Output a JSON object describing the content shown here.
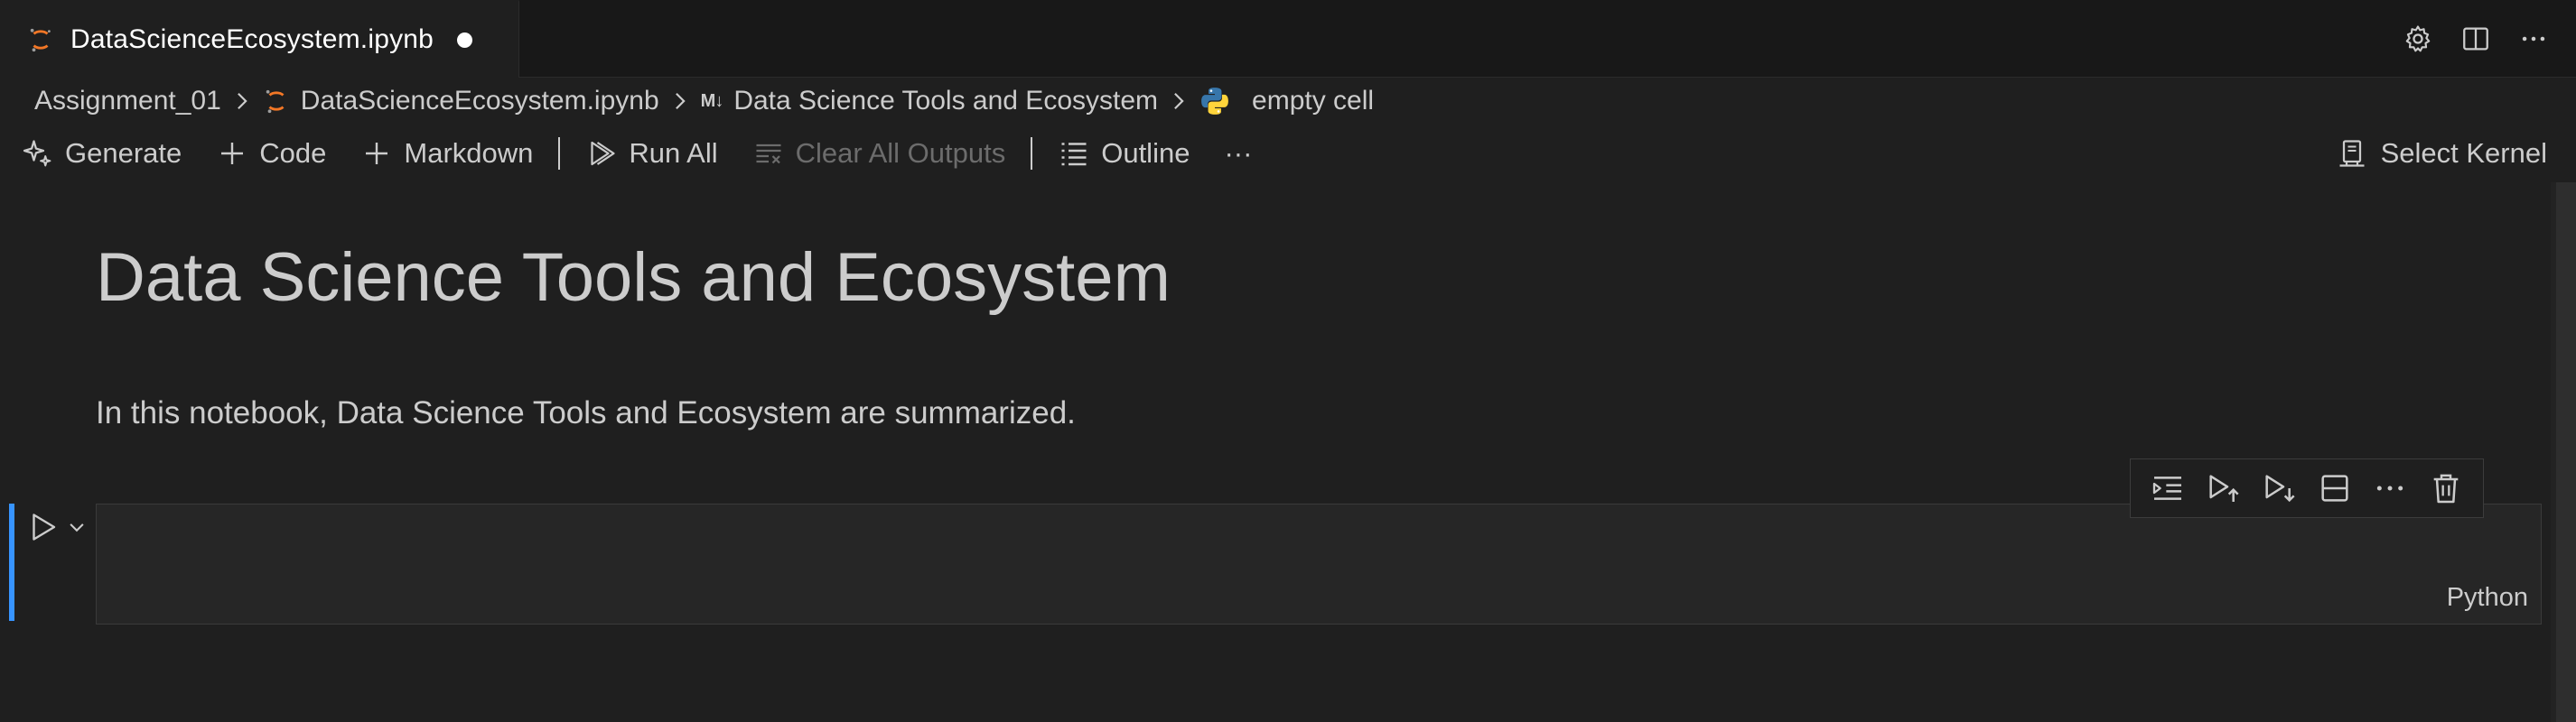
{
  "tab": {
    "title": "DataScienceEcosystem.ipynb",
    "icons": {
      "file": "jupyter-icon",
      "actions": [
        "gear-icon",
        "split-editor-icon",
        "more-icon"
      ]
    }
  },
  "breadcrumb": {
    "items": [
      "Assignment_01",
      "DataScienceEcosystem.ipynb",
      "Data Science Tools and Ecosystem",
      "empty cell"
    ],
    "markdown_badge": "M↓"
  },
  "toolbar": {
    "generate": "Generate",
    "code": "Code",
    "markdown": "Markdown",
    "run_all": "Run All",
    "clear_outputs": "Clear All Outputs",
    "outline": "Outline",
    "more": "···",
    "select_kernel": "Select Kernel"
  },
  "notebook": {
    "markdown_cell": {
      "heading": "Data Science Tools and Ecosystem",
      "paragraph": "In this notebook, Data Science Tools and Ecosystem are summarized."
    },
    "code_cell": {
      "language": "Python",
      "toolbar_icons": [
        "execute-above-icon",
        "execute-cell-and-above-icon",
        "execute-cell-and-below-icon",
        "split-cell-icon",
        "more-icon",
        "delete-icon"
      ]
    }
  },
  "colors": {
    "background": "#1f1f1f",
    "tabbar": "#181818",
    "accent": "#3794ff",
    "jupyter_orange": "#f37726",
    "text": "#cccccc"
  }
}
